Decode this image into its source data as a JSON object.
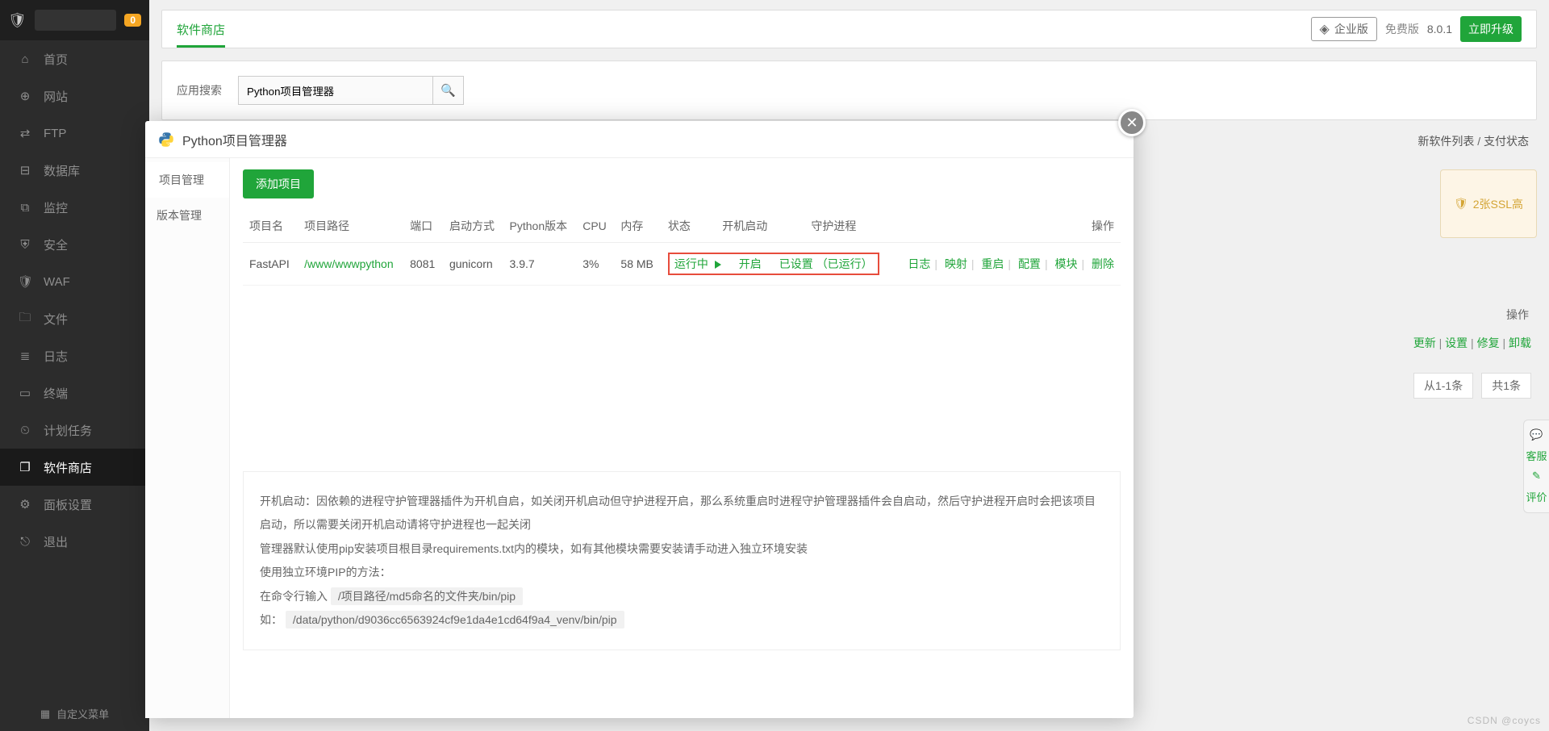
{
  "sidebar": {
    "badge": "0",
    "items": [
      {
        "icon": "⌂",
        "label": "首页"
      },
      {
        "icon": "⊕",
        "label": "网站"
      },
      {
        "icon": "⇄",
        "label": "FTP"
      },
      {
        "icon": "⊟",
        "label": "数据库"
      },
      {
        "icon": "⧉",
        "label": "监控"
      },
      {
        "icon": "⛨",
        "label": "安全"
      },
      {
        "icon": "🛡",
        "label": "WAF"
      },
      {
        "icon": "🗀",
        "label": "文件"
      },
      {
        "icon": "≣",
        "label": "日志"
      },
      {
        "icon": "▭",
        "label": "终端"
      },
      {
        "icon": "⏲",
        "label": "计划任务"
      },
      {
        "icon": "❐",
        "label": "软件商店"
      },
      {
        "icon": "⚙",
        "label": "面板设置"
      },
      {
        "icon": "⎋",
        "label": "退出"
      }
    ],
    "custom": "自定义菜单"
  },
  "topbar": {
    "tab": "软件商店",
    "enterprise": "企业版",
    "free": "免费版",
    "version": "8.0.1",
    "upgrade": "立即升级"
  },
  "search": {
    "label": "应用搜索",
    "value": "Python项目管理器"
  },
  "side_links": {
    "a": "新软件列表",
    "b": "支付状态"
  },
  "ssl": "2张SSL高",
  "opcol": "操作",
  "actions": {
    "update": "更新",
    "setting": "设置",
    "repair": "修复",
    "uninstall": "卸载"
  },
  "pager": {
    "range": "从1-1条",
    "total": "共1条"
  },
  "float": {
    "a": "客服",
    "b": "评价"
  },
  "watermark": "CSDN @coycs",
  "modal": {
    "title": "Python项目管理器",
    "side": [
      {
        "label": "项目管理",
        "active": true
      },
      {
        "label": "版本管理",
        "active": false
      }
    ],
    "addBtn": "添加项目",
    "headers": {
      "name": "项目名",
      "path": "项目路径",
      "port": "端口",
      "start": "启动方式",
      "pyver": "Python版本",
      "cpu": "CPU",
      "mem": "内存",
      "status": "状态",
      "boot": "开机启动",
      "daemon": "守护进程",
      "op": "操作"
    },
    "row": {
      "name": "FastAPI",
      "path": "/www/wwwpython",
      "port": "8081",
      "start": "gunicorn",
      "pyver": "3.9.7",
      "cpu": "3%",
      "mem": "58 MB",
      "status": "运行中",
      "boot": "开启",
      "daemon_set": "已设置",
      "daemon_run": "（已运行）"
    },
    "ops": {
      "log": "日志",
      "map": "映射",
      "restart": "重启",
      "config": "配置",
      "module": "模块",
      "delete": "删除"
    },
    "info": {
      "l1": "开机启动：因依赖的进程守护管理器插件为开机自启，如关闭开机启动但守护进程开启，那么系统重启时进程守护管理器插件会自启动，然后守护进程开启时会把该项目启动，所以需要关闭开机启动请将守护进程也一起关闭",
      "l2": "管理器默认使用pip安装项目根目录requirements.txt内的模块，如有其他模块需要安装请手动进入独立环境安装",
      "l3": "使用独立环境PIP的方法：",
      "l4a": "在命令行输入",
      "l4b": "/项目路径/md5命名的文件夹/bin/pip",
      "l5a": "如：",
      "l5b": "/data/python/d9036cc6563924cf9e1da4e1cd64f9a4_venv/bin/pip"
    }
  }
}
